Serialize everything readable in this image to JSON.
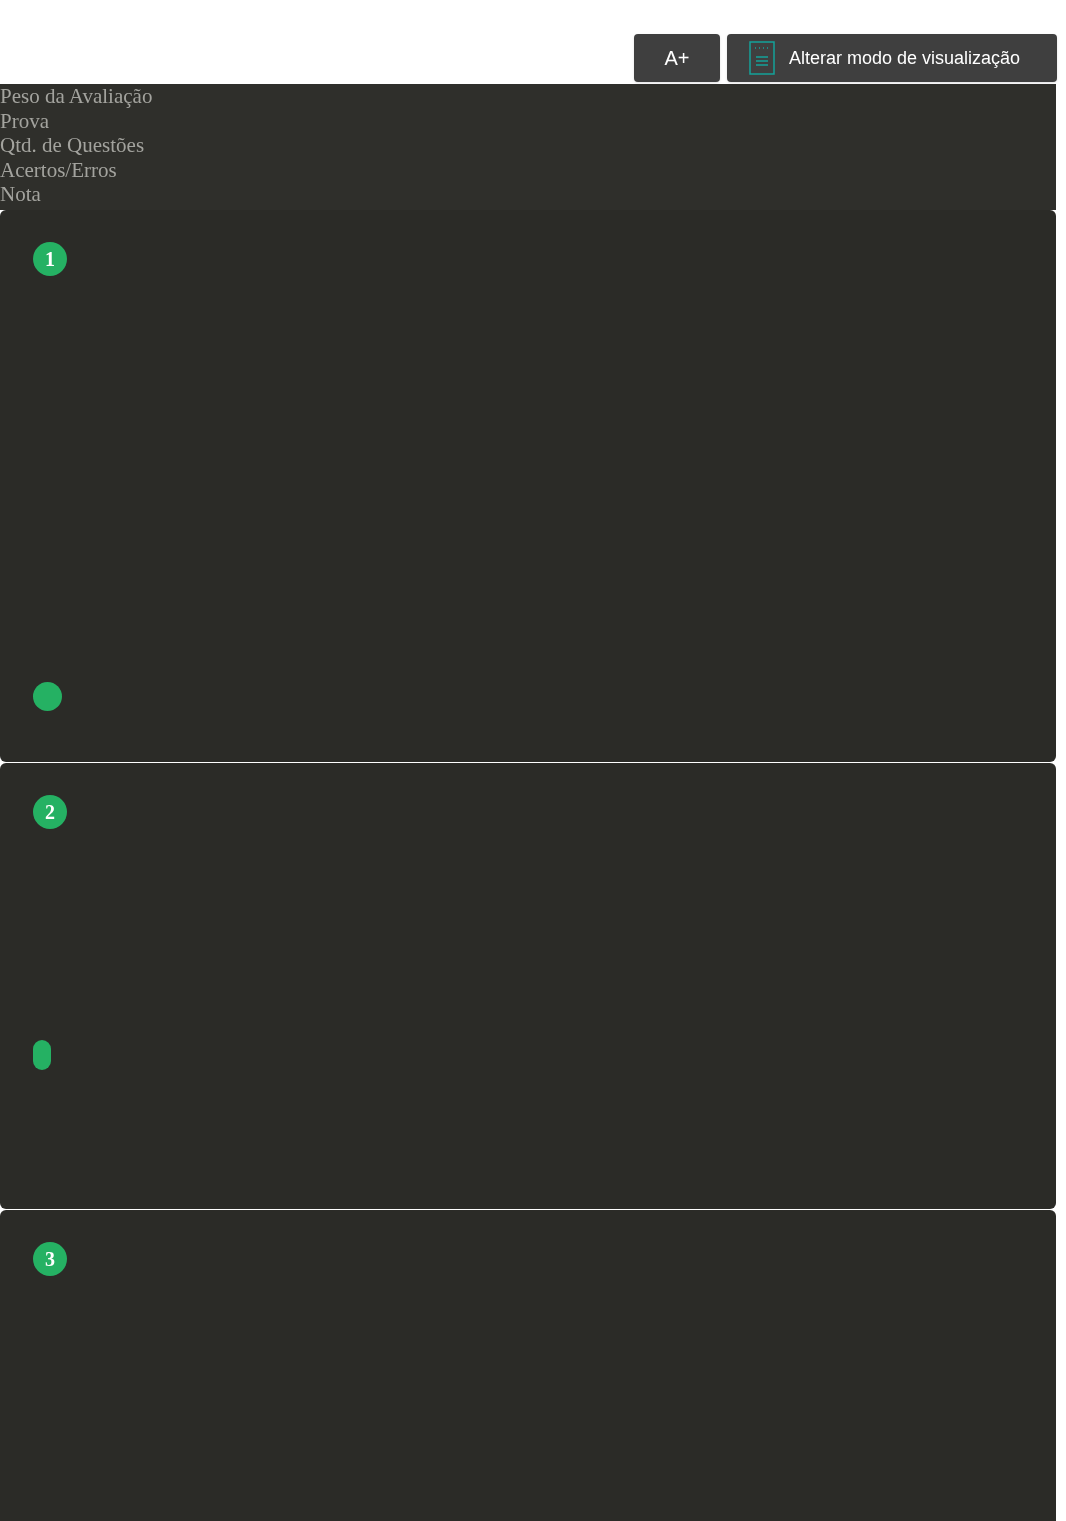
{
  "toolbar": {
    "font_button": "A+",
    "view_mode_button": "Alterar modo de visualização"
  },
  "summary_labels": [
    "Peso da Avaliação",
    "Prova",
    "Qtd. de Questões",
    "Acertos/Erros",
    "Nota"
  ],
  "questions": [
    {
      "number": "1"
    },
    {
      "number": "2"
    },
    {
      "number": "3"
    }
  ]
}
